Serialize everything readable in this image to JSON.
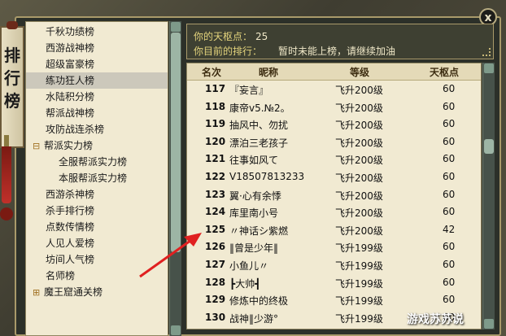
{
  "window": {
    "title_chars": [
      "排",
      "行",
      "榜"
    ],
    "close_label": "x"
  },
  "sidebar": {
    "items": [
      {
        "label": "千秋功绩榜",
        "type": "item"
      },
      {
        "label": "西游战神榜",
        "type": "item"
      },
      {
        "label": "超级富豪榜",
        "type": "item"
      },
      {
        "label": "练功狂人榜",
        "type": "item",
        "selected": true
      },
      {
        "label": "水陆积分榜",
        "type": "item"
      },
      {
        "label": "帮派战神榜",
        "type": "item"
      },
      {
        "label": "攻防战连杀榜",
        "type": "item"
      },
      {
        "label": "帮派实力榜",
        "type": "group",
        "expander": "⊟"
      },
      {
        "label": "全服帮派实力榜",
        "type": "sub"
      },
      {
        "label": "本服帮派实力榜",
        "type": "sub"
      },
      {
        "label": "西游杀神榜",
        "type": "item"
      },
      {
        "label": "杀手排行榜",
        "type": "item"
      },
      {
        "label": "点数传情榜",
        "type": "item"
      },
      {
        "label": "人见人爱榜",
        "type": "item"
      },
      {
        "label": "坊间人气榜",
        "type": "item"
      },
      {
        "label": "名师榜",
        "type": "item"
      },
      {
        "label": "魔王窟通关榜",
        "type": "group",
        "expander": "⊞"
      }
    ]
  },
  "info": {
    "points_label": "你的天枢点：",
    "points_value": "25",
    "rank_label": "你目前的排行：",
    "rank_hint": "暂时未能上榜，请继续加油"
  },
  "table": {
    "headers": {
      "rank": "名次",
      "name": "昵称",
      "level": "等级",
      "score": "天枢点"
    },
    "rows": [
      {
        "rank": "117",
        "name": "『妄言』",
        "level": "飞升200级",
        "score": "60"
      },
      {
        "rank": "118",
        "name": "康帝v5.№2。",
        "level": "飞升200级",
        "score": "60"
      },
      {
        "rank": "119",
        "name": "抽风中、勿扰",
        "level": "飞升200级",
        "score": "60"
      },
      {
        "rank": "120",
        "name": "漂泊三老孩子",
        "level": "飞升200级",
        "score": "60"
      },
      {
        "rank": "121",
        "name": "往事如风て",
        "level": "飞升200级",
        "score": "60"
      },
      {
        "rank": "122",
        "name": "V18507813233",
        "level": "飞升200级",
        "score": "60"
      },
      {
        "rank": "123",
        "name": "翼·心有余悸",
        "level": "飞升200级",
        "score": "60"
      },
      {
        "rank": "124",
        "name": "库里南小号",
        "level": "飞升200级",
        "score": "60"
      },
      {
        "rank": "125",
        "name": "〃神话シ紫燃",
        "level": "飞升200级",
        "score": "42"
      },
      {
        "rank": "126",
        "name": "‖曾是少年‖",
        "level": "飞升199级",
        "score": "60"
      },
      {
        "rank": "127",
        "name": "小鱼儿〃",
        "level": "飞升199级",
        "score": "60"
      },
      {
        "rank": "128",
        "name": "┣大帅┫",
        "level": "飞升199级",
        "score": "60"
      },
      {
        "rank": "129",
        "name": "修炼中的终极",
        "level": "飞升199级",
        "score": "60"
      },
      {
        "rank": "130",
        "name": "战神‖少游°",
        "level": "飞升199级",
        "score": "60"
      }
    ]
  },
  "watermark": "游戏苏苏说",
  "colors": {
    "accent_yellow": "#e3d37c",
    "arrow_red": "#e02020",
    "panel_bg": "#f1ead2"
  }
}
